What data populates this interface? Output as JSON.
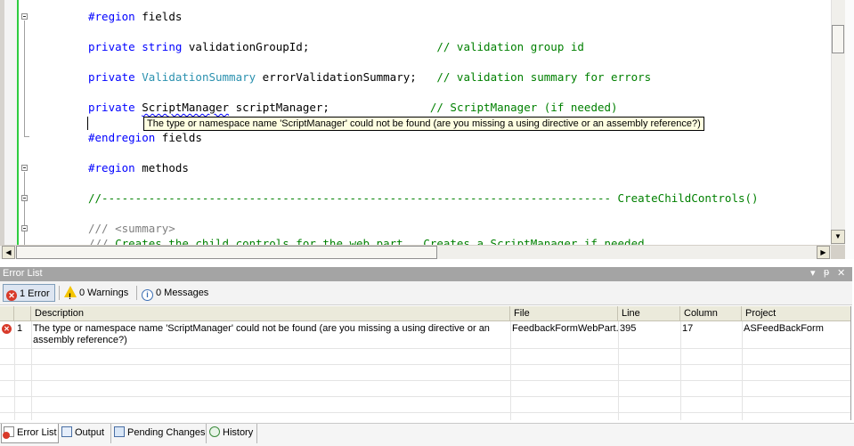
{
  "editor": {
    "lines": [
      {
        "parts": [
          {
            "c": "kw",
            "t": "#region"
          },
          {
            "c": "tx",
            "t": " fields"
          }
        ]
      },
      {
        "parts": [
          {
            "c": "kw",
            "t": "private"
          },
          {
            "c": "tx",
            "t": " "
          },
          {
            "c": "kw",
            "t": "string"
          },
          {
            "c": "tx",
            "t": " validationGroupId;                   "
          },
          {
            "c": "cm",
            "t": "// validation group id"
          }
        ]
      },
      {
        "parts": [
          {
            "c": "kw",
            "t": "private"
          },
          {
            "c": "tx",
            "t": " "
          },
          {
            "c": "ty",
            "t": "ValidationSummary"
          },
          {
            "c": "tx",
            "t": " errorValidationSummary;   "
          },
          {
            "c": "cm",
            "t": "// validation summary for errors"
          }
        ]
      },
      {
        "parts": [
          {
            "c": "kw",
            "t": "private"
          },
          {
            "c": "tx",
            "t": " "
          },
          {
            "c": "sq",
            "t": "ScriptManager"
          },
          {
            "c": "tx",
            "t": " scriptManager;               "
          },
          {
            "c": "cm",
            "t": "// ScriptManager (if needed)"
          }
        ]
      },
      {
        "parts": [
          {
            "c": "kw",
            "t": "#endregion"
          },
          {
            "c": "tx",
            "t": " fields"
          }
        ]
      },
      {
        "parts": [
          {
            "c": "kw",
            "t": "#region"
          },
          {
            "c": "tx",
            "t": " methods"
          }
        ]
      },
      {
        "parts": [
          {
            "c": "cm",
            "t": "//---------------------------------------------------------------------------- CreateChildControls()"
          }
        ]
      },
      {
        "parts": [
          {
            "c": "gr",
            "t": "/// <summary>"
          }
        ]
      },
      {
        "parts": [
          {
            "c": "gr",
            "t": "///"
          },
          {
            "c": "cm",
            "t": " Creates the child controls for the web part.  Creates a ScriptManager if needed"
          }
        ]
      }
    ],
    "tooltip": "The type or namespace name 'ScriptManager' could not be found (are you missing a using directive or an assembly reference?)"
  },
  "panel": {
    "title": "Error List",
    "controls": [
      "▾",
      "ᵽ",
      "✕"
    ],
    "filters": {
      "errors_icon": "✕",
      "errors_label": "1 Error",
      "warnings_icon": "!",
      "warnings_label": "0 Warnings",
      "messages_icon": "i",
      "messages_label": "0 Messages"
    },
    "columns": [
      "Description",
      "File",
      "Line",
      "Column",
      "Project"
    ],
    "rows": [
      {
        "num": "1",
        "description": "The type or namespace name 'ScriptManager' could not be found (are you missing a using directive or an assembly reference?)",
        "file": "FeedbackFormWebPart.",
        "line": "395",
        "column": "17",
        "project": "ASFeedBackForm"
      }
    ]
  },
  "tabs": [
    {
      "label": "Error List",
      "icon": "error-list-icon",
      "active": true
    },
    {
      "label": "Output",
      "icon": "output-icon",
      "active": false
    },
    {
      "label": "Pending Changes",
      "icon": "pending-changes-icon",
      "active": false
    },
    {
      "label": "History",
      "icon": "history-icon",
      "active": false
    }
  ],
  "colors": {
    "keyword": "#0000ff",
    "type": "#2b91af",
    "comment": "#008000",
    "error": "#d83a2a"
  }
}
